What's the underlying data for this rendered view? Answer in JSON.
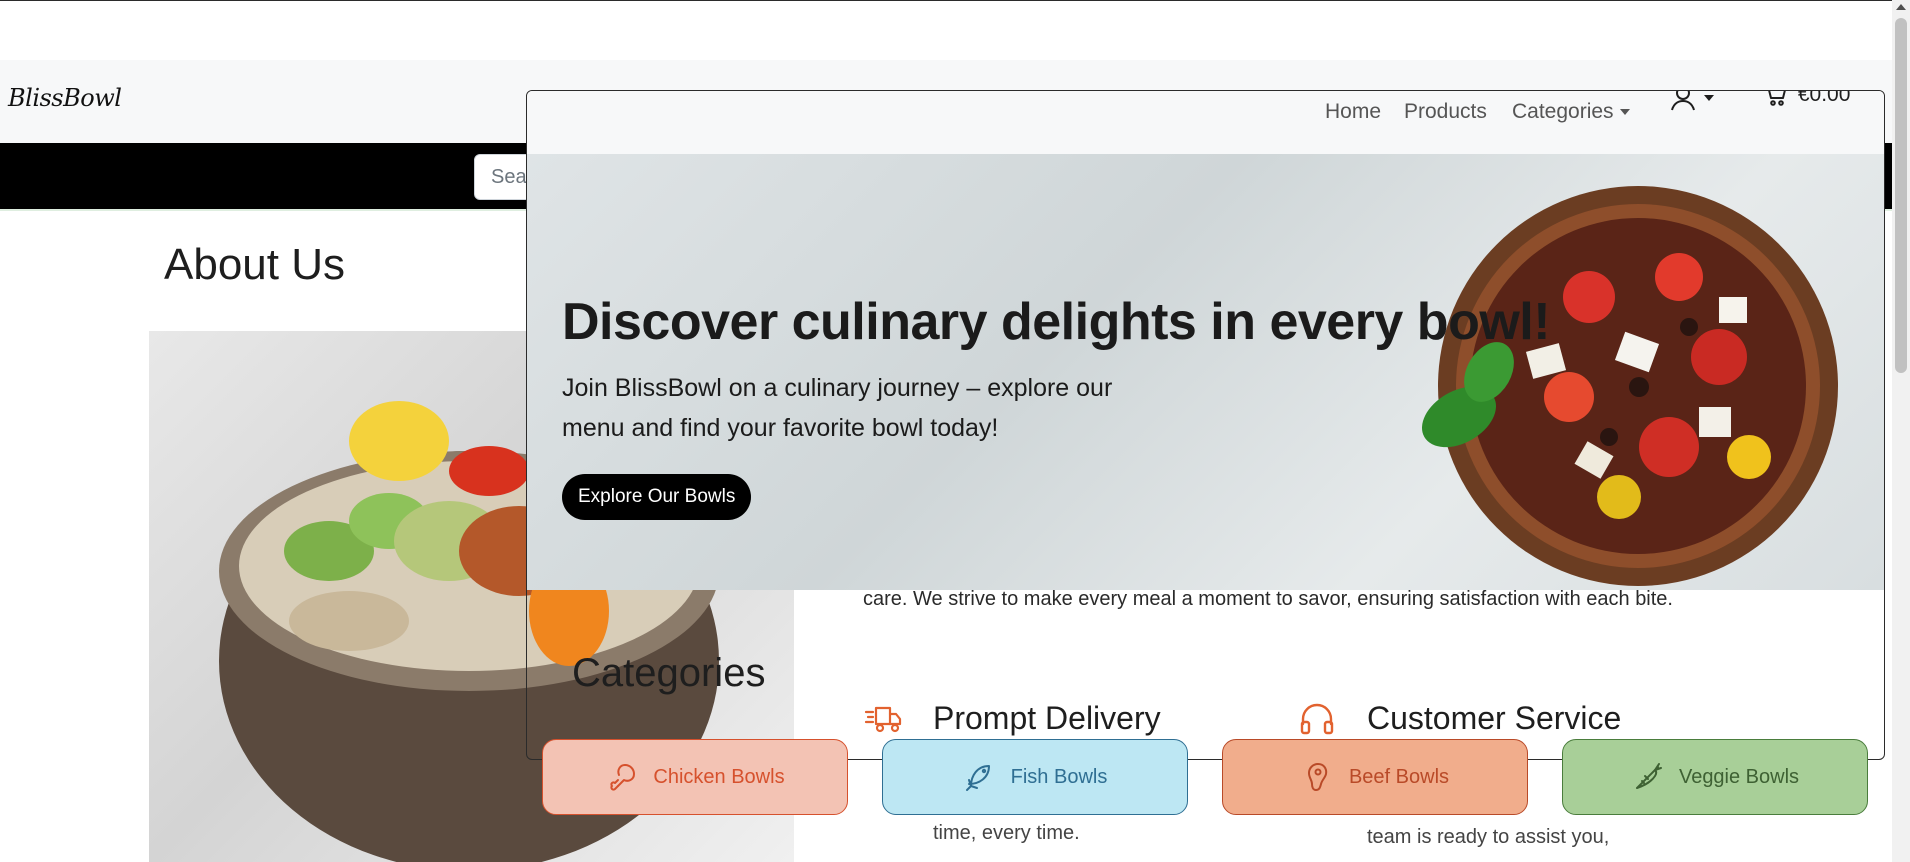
{
  "header": {
    "brand": "BlissBowl",
    "search_placeholder": "Search..."
  },
  "about": {
    "title": "About Us",
    "text": "care. We strive to make every meal a moment to savor, ensuring satisfaction with each bite."
  },
  "features": [
    {
      "title": "Prompt Delivery",
      "desc_visible": "time, every time.",
      "icon": "delivery-truck-icon"
    },
    {
      "title": "Customer Service",
      "desc_visible": "team is ready to assist you,",
      "icon": "headphones-icon"
    }
  ],
  "overlay_nav": {
    "home": "Home",
    "products": "Products",
    "categories": "Categories",
    "cart_total": "€0.00"
  },
  "hero": {
    "title": "Discover culinary delights in every bowl!",
    "subtitle": "Join BlissBowl on a culinary journey – explore our menu and find your favorite bowl today!",
    "cta": "Explore Our Bowls"
  },
  "categories": {
    "heading": "Categories",
    "items": [
      {
        "label": "Chicken Bowls",
        "icon": "chicken-leg-icon",
        "color": "#d6512d"
      },
      {
        "label": "Fish Bowls",
        "icon": "fish-icon",
        "color": "#2f6f93"
      },
      {
        "label": "Beef Bowls",
        "icon": "beef-icon",
        "color": "#b94a28"
      },
      {
        "label": "Veggie Bowls",
        "icon": "carrot-icon",
        "color": "#4a7d3c"
      }
    ]
  }
}
